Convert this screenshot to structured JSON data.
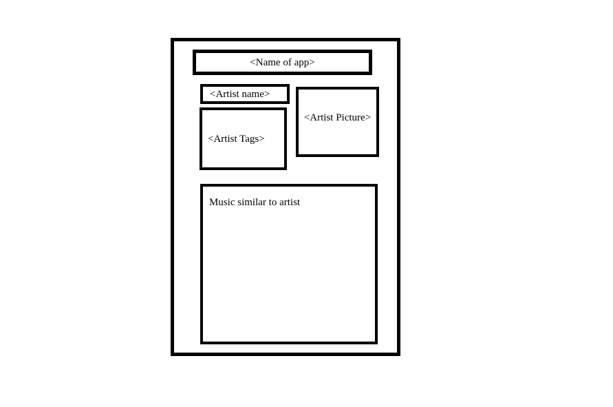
{
  "wireframe": {
    "app_name": "<Name of app>",
    "artist_name": "<Artist name>",
    "artist_tags": "<Artist Tags>",
    "artist_picture": "<Artist Picture>",
    "similar_music": "Music similar to artist"
  },
  "colors": {
    "stroke": "#000000",
    "background": "#ffffff"
  }
}
